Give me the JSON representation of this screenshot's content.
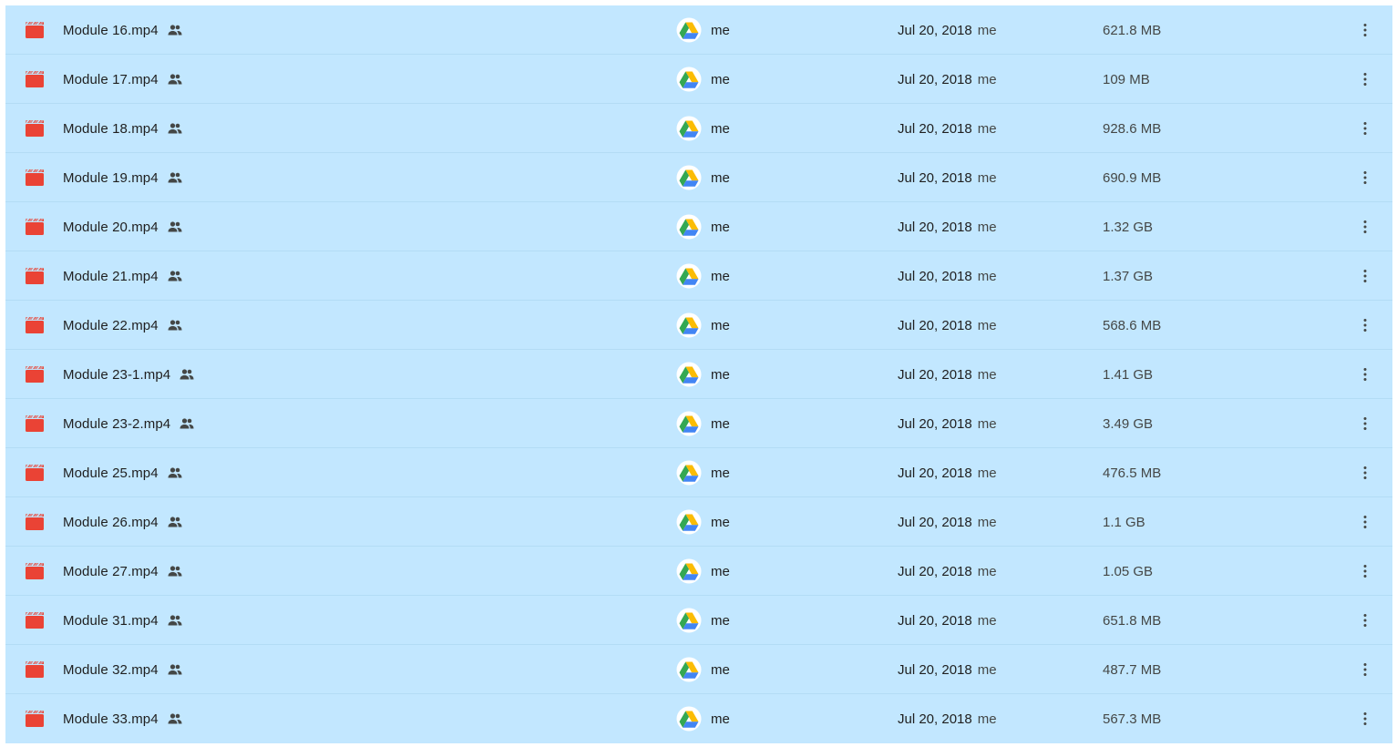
{
  "colors": {
    "selection_background": "#c2e7ff",
    "video_icon": "#ea4335",
    "text_primary": "#1f1f1f",
    "text_secondary": "#444746"
  },
  "icons": {
    "file_type": "video-icon",
    "shared": "people-icon",
    "location": "google-drive-icon",
    "more": "more-vert-icon"
  },
  "files": [
    {
      "name": "Module 16.mp4",
      "owner": "me",
      "modified": "Jul 20, 2018",
      "modified_by": "me",
      "size": "621.8 MB"
    },
    {
      "name": "Module 17.mp4",
      "owner": "me",
      "modified": "Jul 20, 2018",
      "modified_by": "me",
      "size": "109 MB"
    },
    {
      "name": "Module 18.mp4",
      "owner": "me",
      "modified": "Jul 20, 2018",
      "modified_by": "me",
      "size": "928.6 MB"
    },
    {
      "name": "Module 19.mp4",
      "owner": "me",
      "modified": "Jul 20, 2018",
      "modified_by": "me",
      "size": "690.9 MB"
    },
    {
      "name": "Module 20.mp4",
      "owner": "me",
      "modified": "Jul 20, 2018",
      "modified_by": "me",
      "size": "1.32 GB"
    },
    {
      "name": "Module 21.mp4",
      "owner": "me",
      "modified": "Jul 20, 2018",
      "modified_by": "me",
      "size": "1.37 GB"
    },
    {
      "name": "Module 22.mp4",
      "owner": "me",
      "modified": "Jul 20, 2018",
      "modified_by": "me",
      "size": "568.6 MB"
    },
    {
      "name": "Module 23-1.mp4",
      "owner": "me",
      "modified": "Jul 20, 2018",
      "modified_by": "me",
      "size": "1.41 GB"
    },
    {
      "name": "Module 23-2.mp4",
      "owner": "me",
      "modified": "Jul 20, 2018",
      "modified_by": "me",
      "size": "3.49 GB"
    },
    {
      "name": "Module 25.mp4",
      "owner": "me",
      "modified": "Jul 20, 2018",
      "modified_by": "me",
      "size": "476.5 MB"
    },
    {
      "name": "Module 26.mp4",
      "owner": "me",
      "modified": "Jul 20, 2018",
      "modified_by": "me",
      "size": "1.1 GB"
    },
    {
      "name": "Module 27.mp4",
      "owner": "me",
      "modified": "Jul 20, 2018",
      "modified_by": "me",
      "size": "1.05 GB"
    },
    {
      "name": "Module 31.mp4",
      "owner": "me",
      "modified": "Jul 20, 2018",
      "modified_by": "me",
      "size": "651.8 MB"
    },
    {
      "name": "Module 32.mp4",
      "owner": "me",
      "modified": "Jul 20, 2018",
      "modified_by": "me",
      "size": "487.7 MB"
    },
    {
      "name": "Module 33.mp4",
      "owner": "me",
      "modified": "Jul 20, 2018",
      "modified_by": "me",
      "size": "567.3 MB"
    }
  ]
}
